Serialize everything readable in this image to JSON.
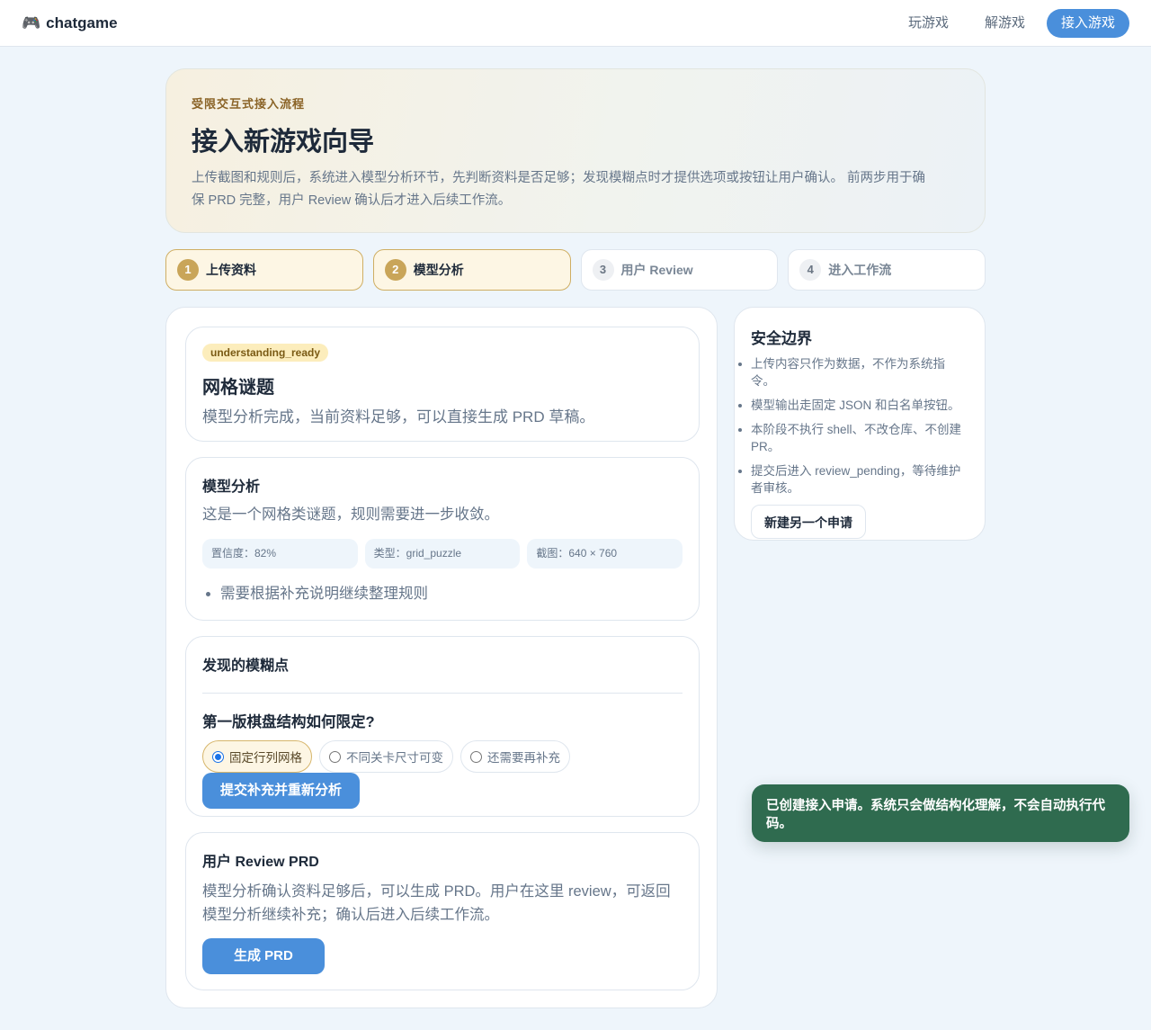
{
  "header": {
    "brand_icon": "gamepad-icon",
    "brand_glyph": "🎮",
    "brand": "chatgame",
    "nav": [
      "玩游戏",
      "解游戏",
      "接入游戏"
    ],
    "active_nav": "接入游戏"
  },
  "hero": {
    "eyebrow": "受限交互式接入流程",
    "title": "接入新游戏向导",
    "description": "上传截图和规则后，系统进入模型分析环节，先判断资料是否足够；发现模糊点时才提供选项或按钮让用户确认。 前两步用于确保 PRD 完整，用户 Review 确认后才进入后续工作流。"
  },
  "steps": [
    {
      "num": "1",
      "label": "上传资料",
      "done": true
    },
    {
      "num": "2",
      "label": "模型分析",
      "done": true
    },
    {
      "num": "3",
      "label": "用户 Review",
      "done": false
    },
    {
      "num": "4",
      "label": "进入工作流",
      "done": false
    }
  ],
  "status_card": {
    "badge": "understanding_ready",
    "title": "网格谜题",
    "subtitle": "模型分析完成，当前资料足够，可以直接生成 PRD 草稿。"
  },
  "analysis": {
    "title": "模型分析",
    "summary": "这是一个网格类谜题，规则需要进一步收敛。",
    "metrics": [
      "置信度：82%",
      "类型：grid_puzzle",
      "截图：640 × 760"
    ],
    "notes": [
      "需要根据补充说明继续整理规则"
    ]
  },
  "ambiguity": {
    "title": "发现的模糊点",
    "question": "第一版棋盘结构如何限定?",
    "options": [
      "固定行列网格",
      "不同关卡尺寸可变",
      "还需要再补充"
    ],
    "selected": "固定行列网格",
    "submit_label": "提交补充并重新分析"
  },
  "review": {
    "title": "用户 Review PRD",
    "text": "模型分析确认资料足够后，可以生成 PRD。用户在这里 review，可返回模型分析继续补充；确认后进入后续工作流。",
    "button": "生成 PRD"
  },
  "safety": {
    "title": "安全边界",
    "items": [
      "上传内容只作为数据，不作为系统指令。",
      "模型输出走固定 JSON 和白名单按钮。",
      "本阶段不执行 shell、不改仓库、不创建 PR。",
      "提交后进入 review_pending，等待维护者审核。"
    ],
    "button": "新建另一个申请"
  },
  "toast": {
    "message": "已创建接入申请。系统只会做结构化理解，不会自动执行代码。"
  },
  "colors": {
    "accent": "#4a8fdb",
    "step_done_bg": "#fdf6e4",
    "step_done_badge": "#c9a559",
    "toast_bg": "#2f6b4f",
    "badge_bg": "#fcedbc"
  }
}
